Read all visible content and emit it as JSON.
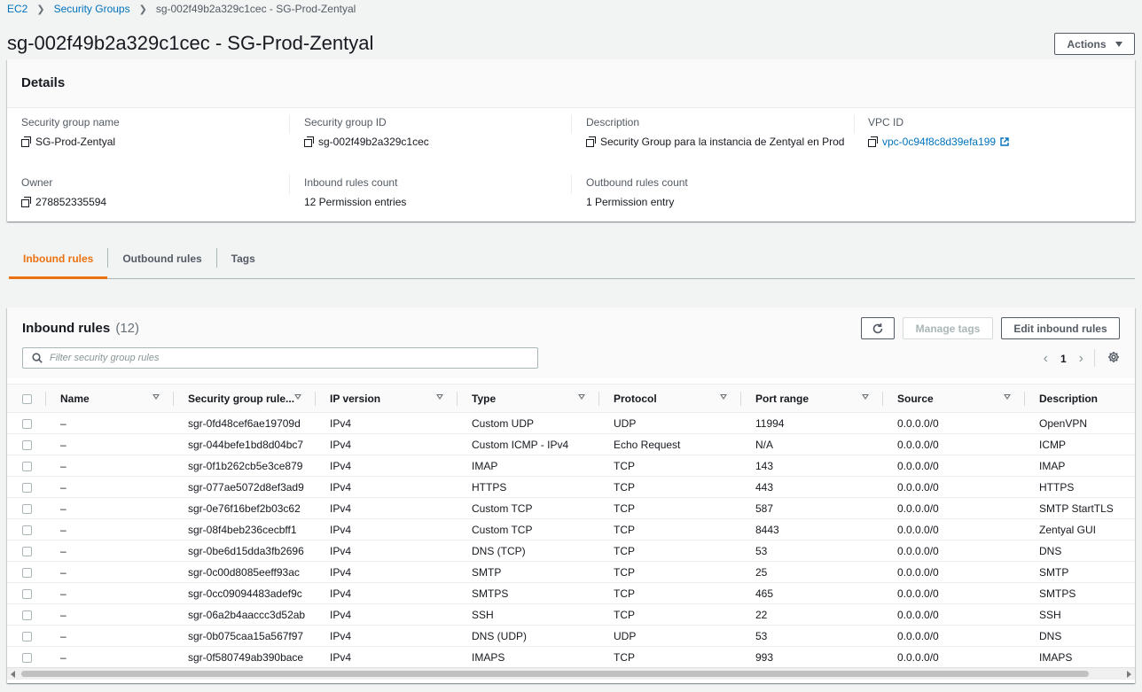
{
  "breadcrumb": {
    "items": [
      "EC2",
      "Security Groups"
    ],
    "current": "sg-002f49b2a329c1cec - SG-Prod-Zentyal"
  },
  "title": "sg-002f49b2a329c1cec - SG-Prod-Zentyal",
  "actions_label": "Actions",
  "details": {
    "header": "Details",
    "sg_name": {
      "label": "Security group name",
      "value": "SG-Prod-Zentyal"
    },
    "sg_id": {
      "label": "Security group ID",
      "value": "sg-002f49b2a329c1cec"
    },
    "description": {
      "label": "Description",
      "value": "Security Group para la instancia de Zentyal en Prod"
    },
    "vpc_id": {
      "label": "VPC ID",
      "value": "vpc-0c94f8c8d39efa199"
    },
    "owner": {
      "label": "Owner",
      "value": "278852335594"
    },
    "inbound_count": {
      "label": "Inbound rules count",
      "value": "12 Permission entries"
    },
    "outbound_count": {
      "label": "Outbound rules count",
      "value": "1 Permission entry"
    }
  },
  "tabs": [
    "Inbound rules",
    "Outbound rules",
    "Tags"
  ],
  "active_tab": "Inbound rules",
  "inbound": {
    "title": "Inbound rules",
    "count": "(12)",
    "manage_tags_label": "Manage tags",
    "edit_label": "Edit inbound rules",
    "filter_placeholder": "Filter security group rules",
    "page": "1",
    "columns": [
      "Name",
      "Security group rule...",
      "IP version",
      "Type",
      "Protocol",
      "Port range",
      "Source",
      "Description"
    ],
    "rows": [
      [
        "–",
        "sgr-0fd48cef6ae19709d",
        "IPv4",
        "Custom UDP",
        "UDP",
        "11994",
        "0.0.0.0/0",
        "OpenVPN"
      ],
      [
        "–",
        "sgr-044befe1bd8d04bc7",
        "IPv4",
        "Custom ICMP - IPv4",
        "Echo Request",
        "N/A",
        "0.0.0.0/0",
        "ICMP"
      ],
      [
        "–",
        "sgr-0f1b262cb5e3ce879",
        "IPv4",
        "IMAP",
        "TCP",
        "143",
        "0.0.0.0/0",
        "IMAP"
      ],
      [
        "–",
        "sgr-077ae5072d8ef3ad9",
        "IPv4",
        "HTTPS",
        "TCP",
        "443",
        "0.0.0.0/0",
        "HTTPS"
      ],
      [
        "–",
        "sgr-0e76f16bef2b03c62",
        "IPv4",
        "Custom TCP",
        "TCP",
        "587",
        "0.0.0.0/0",
        "SMTP StartTLS"
      ],
      [
        "–",
        "sgr-08f4beb236cecbff1",
        "IPv4",
        "Custom TCP",
        "TCP",
        "8443",
        "0.0.0.0/0",
        "Zentyal GUI"
      ],
      [
        "–",
        "sgr-0be6d15dda3fb2696",
        "IPv4",
        "DNS (TCP)",
        "TCP",
        "53",
        "0.0.0.0/0",
        "DNS"
      ],
      [
        "–",
        "sgr-0c00d8085eeff93ac",
        "IPv4",
        "SMTP",
        "TCP",
        "25",
        "0.0.0.0/0",
        "SMTP"
      ],
      [
        "–",
        "sgr-0cc09094483adef9c",
        "IPv4",
        "SMTPS",
        "TCP",
        "465",
        "0.0.0.0/0",
        "SMTPS"
      ],
      [
        "–",
        "sgr-06a2b4aaccc3d52ab",
        "IPv4",
        "SSH",
        "TCP",
        "22",
        "0.0.0.0/0",
        "SSH"
      ],
      [
        "–",
        "sgr-0b075caa15a567f97",
        "IPv4",
        "DNS (UDP)",
        "UDP",
        "53",
        "0.0.0.0/0",
        "DNS"
      ],
      [
        "–",
        "sgr-0f580749ab390bace",
        "IPv4",
        "IMAPS",
        "TCP",
        "993",
        "0.0.0.0/0",
        "IMAPS"
      ]
    ]
  },
  "colors": {
    "accent": "#ec7211",
    "link": "#0073bb",
    "text": "#16191f",
    "muted": "#545b64"
  }
}
